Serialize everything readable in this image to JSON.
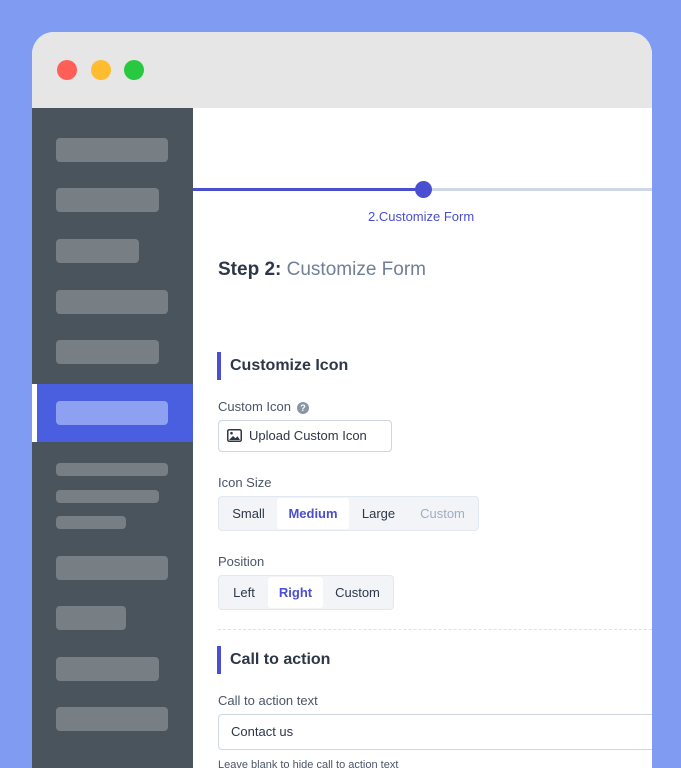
{
  "stepper": {
    "current_caption": "2.Customize Form",
    "progress_percent": 50
  },
  "step": {
    "prefix": "Step 2:",
    "title": "Customize Form"
  },
  "customize_icon": {
    "heading": "Customize Icon",
    "custom_icon_label": "Custom Icon",
    "help_glyph": "?",
    "upload_button": "Upload Custom Icon",
    "icon_size_label": "Icon Size",
    "icon_size_options": [
      "Small",
      "Medium",
      "Large",
      "Custom"
    ],
    "icon_size_selected": "Medium",
    "position_label": "Position",
    "position_options": [
      "Left",
      "Right",
      "Custom"
    ],
    "position_selected": "Right"
  },
  "call_to_action": {
    "heading": "Call to action",
    "text_label": "Call to action text",
    "text_value": "Contact us",
    "hint": "Leave blank to hide call to action text"
  },
  "colors": {
    "accent": "#4a4fd1",
    "sidebar_bg": "#4a545c",
    "sidebar_active": "#4a5fe0",
    "frame_bg": "#7f9bf2"
  },
  "icons": [
    "help-icon",
    "image-icon"
  ]
}
